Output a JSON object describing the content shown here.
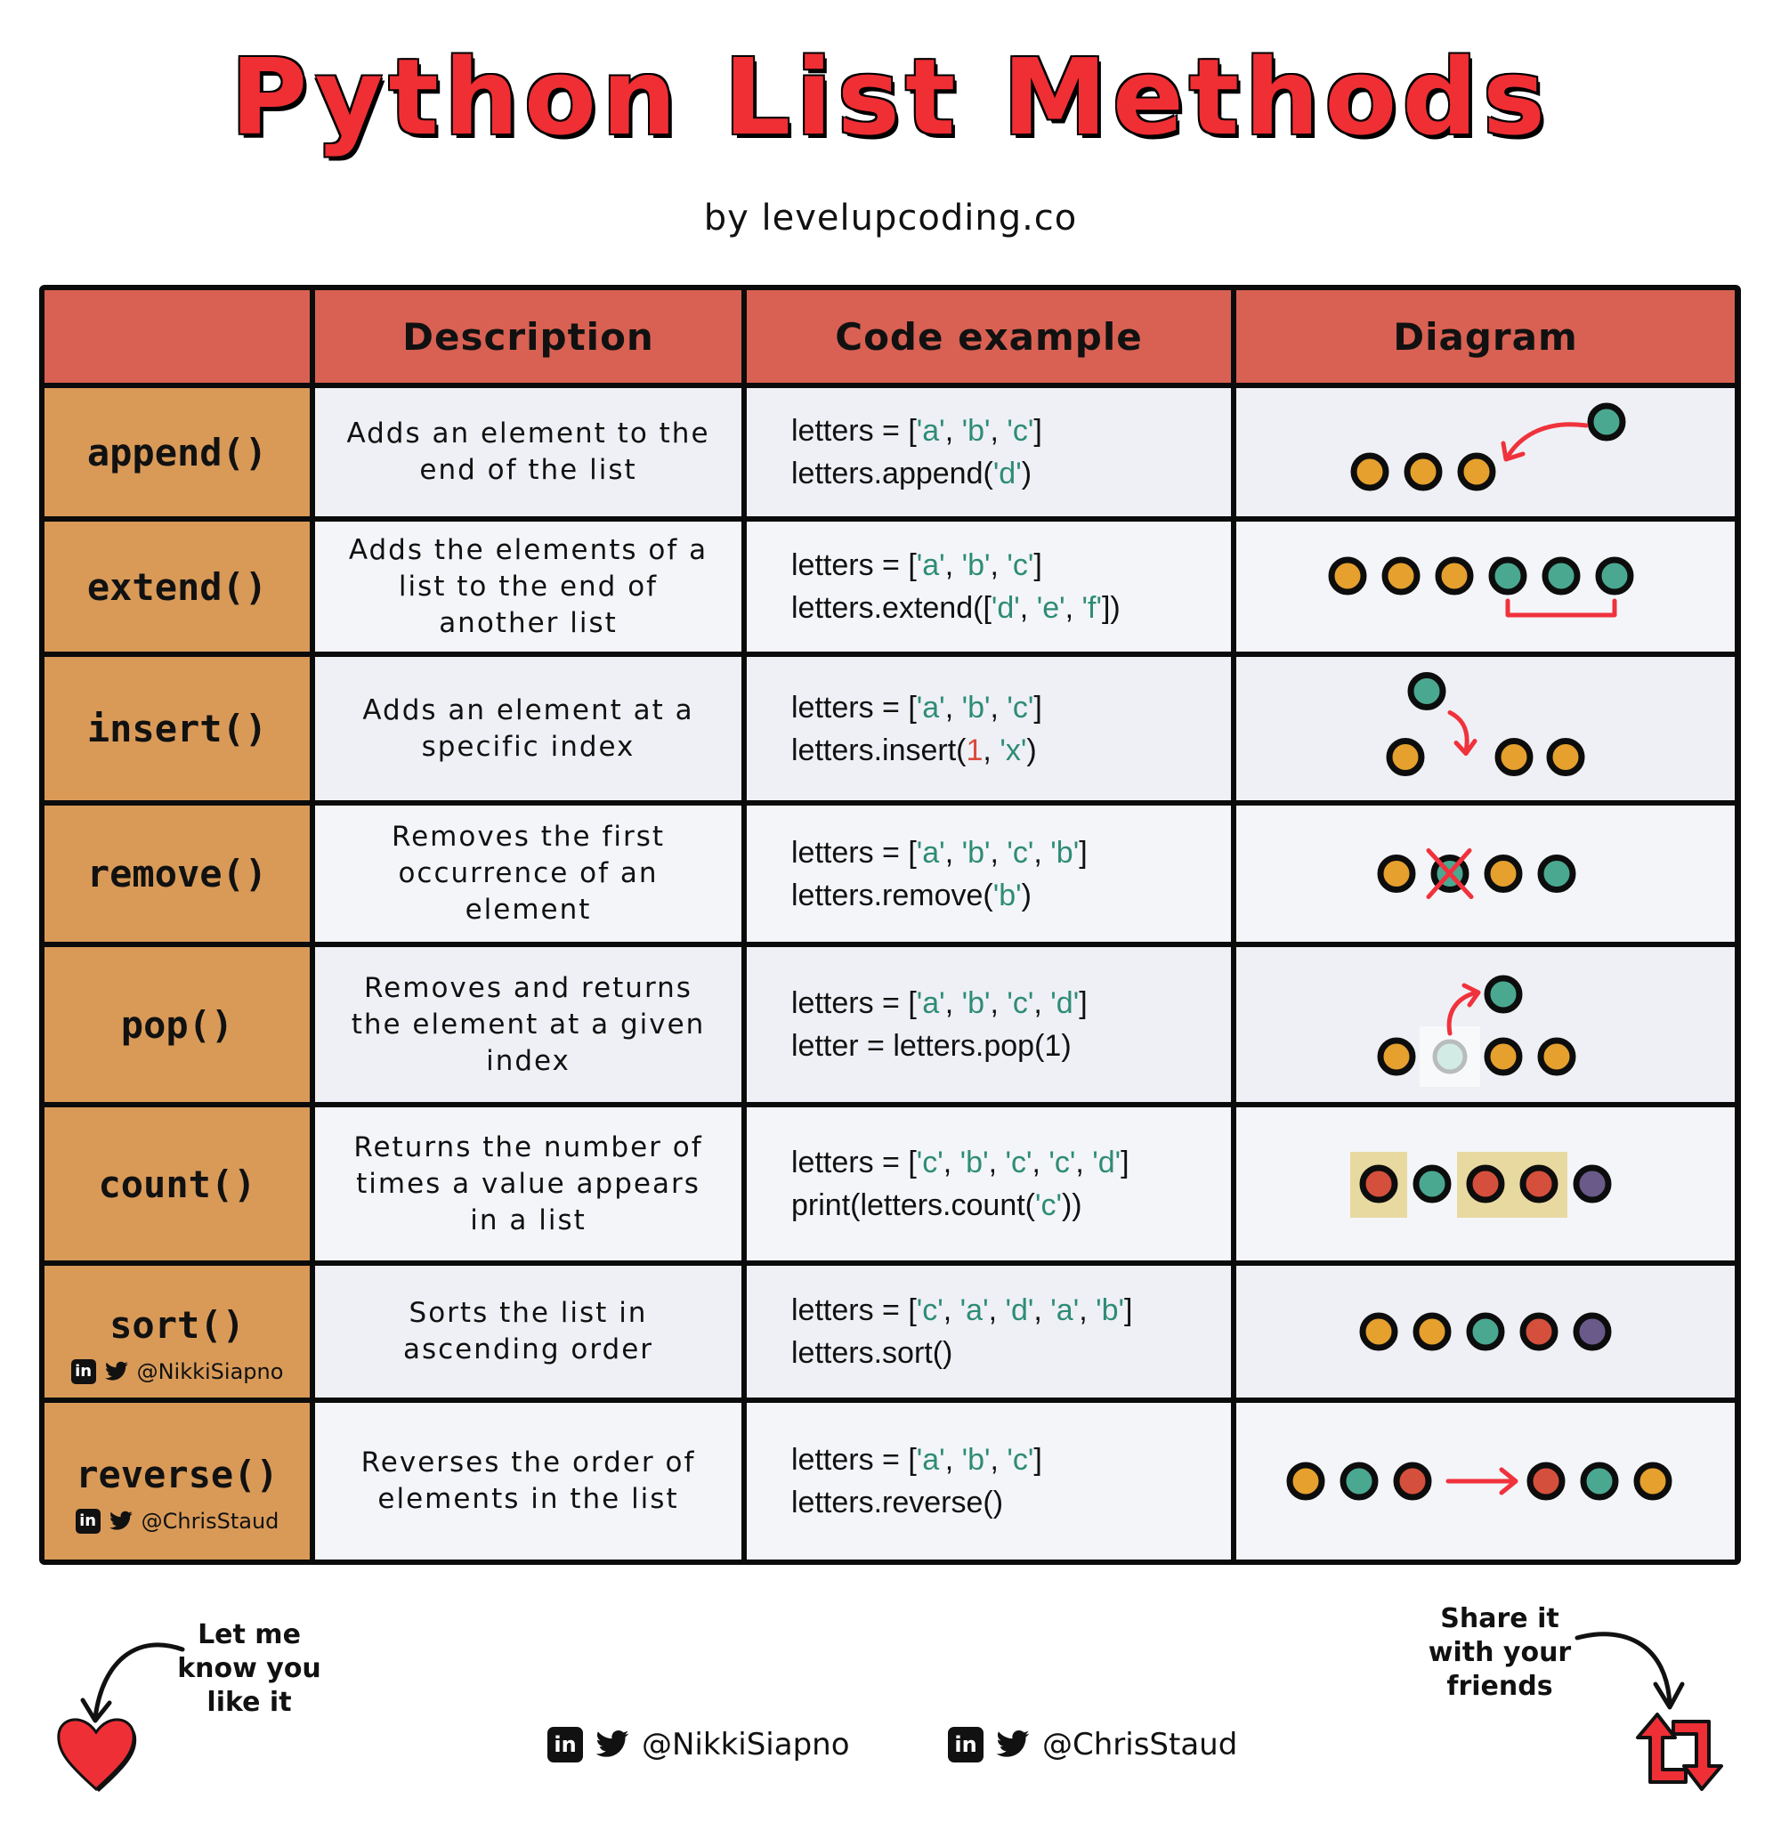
{
  "title": "Python List Methods",
  "subtitle": "by levelupcoding.co",
  "colors": {
    "title_red": "#ef2f34",
    "header_bg": "#d86153",
    "method_bg": "#d99a58",
    "dot_yellow": "#e5a02e",
    "dot_teal": "#4aa891",
    "dot_red": "#d4503c",
    "dot_purple": "#6a5a8a",
    "arrow_red": "#f0323c",
    "highlight": "#e8d9a0"
  },
  "table": {
    "headers": [
      "",
      "Description",
      "Code example",
      "Diagram"
    ],
    "rows": [
      {
        "method": "append()",
        "description": "Adds an element to the end of the list",
        "code": [
          [
            [
              "letters = [",
              "t"
            ],
            [
              "'a'",
              "s"
            ],
            [
              ", ",
              "t"
            ],
            [
              "'b'",
              "s"
            ],
            [
              ", ",
              "t"
            ],
            [
              "'c'",
              "s"
            ],
            [
              "]",
              "t"
            ]
          ],
          [
            [
              "letters.append(",
              "t"
            ],
            [
              "'d'",
              "s"
            ],
            [
              ")",
              "t"
            ]
          ]
        ],
        "diagram": {
          "type": "append",
          "list": [
            "yellow",
            "yellow",
            "yellow"
          ],
          "added": "teal"
        }
      },
      {
        "method": "extend()",
        "description": "Adds the elements of a list to the end of another list",
        "code": [
          [
            [
              "letters = [",
              "t"
            ],
            [
              "'a'",
              "s"
            ],
            [
              ", ",
              "t"
            ],
            [
              "'b'",
              "s"
            ],
            [
              ", ",
              "t"
            ],
            [
              "'c'",
              "s"
            ],
            [
              "]",
              "t"
            ]
          ],
          [
            [
              "letters.extend([",
              "t"
            ],
            [
              "'d'",
              "s"
            ],
            [
              ", ",
              "t"
            ],
            [
              "'e'",
              "s"
            ],
            [
              ", ",
              "t"
            ],
            [
              "'f'",
              "s"
            ],
            [
              "])",
              "t"
            ]
          ]
        ],
        "diagram": {
          "type": "extend",
          "list": [
            "yellow",
            "yellow",
            "yellow",
            "teal",
            "teal",
            "teal"
          ],
          "bracket_from": 3,
          "bracket_to": 5
        }
      },
      {
        "method": "insert()",
        "description": "Adds an element at a specific index",
        "code": [
          [
            [
              "letters = [",
              "t"
            ],
            [
              "'a'",
              "s"
            ],
            [
              ", ",
              "t"
            ],
            [
              "'b'",
              "s"
            ],
            [
              ", ",
              "t"
            ],
            [
              "'c'",
              "s"
            ],
            [
              "]",
              "t"
            ]
          ],
          [
            [
              "letters.insert(",
              "t"
            ],
            [
              "1",
              "n"
            ],
            [
              ", ",
              "t"
            ],
            [
              "'x'",
              "s"
            ],
            [
              ")",
              "t"
            ]
          ]
        ],
        "diagram": {
          "type": "insert",
          "list": [
            "yellow",
            "yellow",
            "yellow"
          ],
          "inserted": "teal",
          "index": 1
        }
      },
      {
        "method": "remove()",
        "description": "Removes the first occurrence of an element",
        "code": [
          [
            [
              "letters = [",
              "t"
            ],
            [
              "'a'",
              "s"
            ],
            [
              ", ",
              "t"
            ],
            [
              "'b'",
              "s"
            ],
            [
              ", ",
              "t"
            ],
            [
              "'c'",
              "s"
            ],
            [
              ", ",
              "t"
            ],
            [
              "'b'",
              "s"
            ],
            [
              "]",
              "t"
            ]
          ],
          [
            [
              "letters.remove(",
              "t"
            ],
            [
              "'b'",
              "s"
            ],
            [
              ")",
              "t"
            ]
          ]
        ],
        "diagram": {
          "type": "remove",
          "list": [
            "yellow",
            "teal",
            "yellow",
            "teal"
          ],
          "crossed_index": 1
        }
      },
      {
        "method": "pop()",
        "description": "Removes and returns the element at a given index",
        "code": [
          [
            [
              "letters = [",
              "t"
            ],
            [
              "'a'",
              "s"
            ],
            [
              ", ",
              "t"
            ],
            [
              "'b'",
              "s"
            ],
            [
              ", ",
              "t"
            ],
            [
              "'c'",
              "s"
            ],
            [
              ", ",
              "t"
            ],
            [
              "'d'",
              "s"
            ],
            [
              "]",
              "t"
            ]
          ],
          [
            [
              "letter = letters.pop(1)",
              "t"
            ]
          ]
        ],
        "diagram": {
          "type": "pop",
          "list": [
            "yellow",
            "ghost",
            "yellow",
            "yellow"
          ],
          "popped": "teal",
          "index": 1
        }
      },
      {
        "method": "count()",
        "description": "Returns the number of times a value appears in a list",
        "code": [
          [
            [
              "letters = [",
              "t"
            ],
            [
              "'c'",
              "s"
            ],
            [
              ", ",
              "t"
            ],
            [
              "'b'",
              "s"
            ],
            [
              ", ",
              "t"
            ],
            [
              "'c'",
              "s"
            ],
            [
              ", ",
              "t"
            ],
            [
              "'c'",
              "s"
            ],
            [
              ", ",
              "t"
            ],
            [
              "'d'",
              "s"
            ],
            [
              "]",
              "t"
            ]
          ],
          [
            [
              "print(letters.count(",
              "t"
            ],
            [
              "'c'",
              "s"
            ],
            [
              "))",
              "t"
            ]
          ]
        ],
        "diagram": {
          "type": "count",
          "list": [
            "red",
            "teal",
            "red",
            "red",
            "purple"
          ],
          "highlighted": [
            0,
            2,
            3
          ]
        }
      },
      {
        "method": "sort()",
        "credit": "@NikkiSiapno",
        "description": "Sorts the list in ascending order",
        "code": [
          [
            [
              "letters = [",
              "t"
            ],
            [
              "'c'",
              "s"
            ],
            [
              ", ",
              "t"
            ],
            [
              "'a'",
              "s"
            ],
            [
              ", ",
              "t"
            ],
            [
              "'d'",
              "s"
            ],
            [
              ", ",
              "t"
            ],
            [
              "'a'",
              "s"
            ],
            [
              ", ",
              "t"
            ],
            [
              "'b'",
              "s"
            ],
            [
              "]",
              "t"
            ]
          ],
          [
            [
              "letters.sort()",
              "t"
            ]
          ]
        ],
        "diagram": {
          "type": "sort",
          "list": [
            "yellow",
            "yellow",
            "teal",
            "red",
            "purple"
          ]
        }
      },
      {
        "method": "reverse()",
        "credit": "@ChrisStaud",
        "description": "Reverses the order of elements in the list",
        "code": [
          [
            [
              "letters = [",
              "t"
            ],
            [
              "'a'",
              "s"
            ],
            [
              ", ",
              "t"
            ],
            [
              "'b'",
              "s"
            ],
            [
              ", ",
              "t"
            ],
            [
              "'c'",
              "s"
            ],
            [
              "]",
              "t"
            ]
          ],
          [
            [
              "letters.reverse()",
              "t"
            ]
          ]
        ],
        "diagram": {
          "type": "reverse",
          "list": [
            "yellow",
            "teal",
            "red"
          ],
          "result": [
            "red",
            "teal",
            "yellow"
          ]
        }
      }
    ]
  },
  "footer": {
    "left_note": [
      "Let me",
      "know you",
      "like it"
    ],
    "right_note": [
      "Share it",
      "with your",
      "friends"
    ],
    "handles": [
      "@NikkiSiapno",
      "@ChrisStaud"
    ],
    "linkedin_label": "in"
  }
}
